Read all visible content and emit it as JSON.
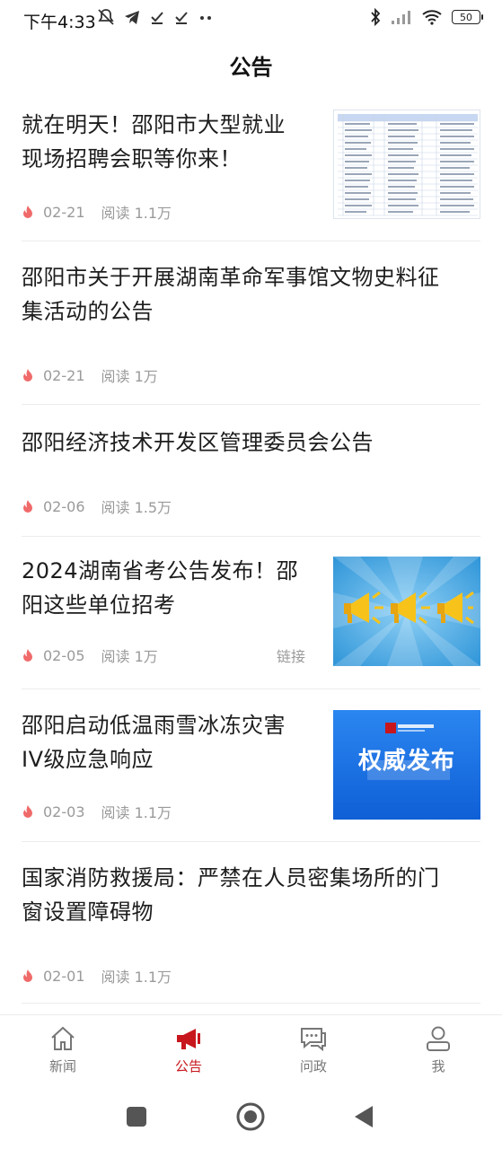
{
  "status_bar": {
    "time": "下午4:33",
    "battery": "50"
  },
  "page_title": "公告",
  "items": [
    {
      "title_line1": "就在明天！邵阳市大型就业",
      "title_line2": "现场招聘会职等你来！",
      "date": "02-21",
      "reads": "阅读 1.1万",
      "thumb": "table-image"
    },
    {
      "title_line1": "邵阳市关于开展湖南革命军事馆文物史料征",
      "title_line2": "集活动的公告",
      "date": "02-21",
      "reads": "阅读 1万"
    },
    {
      "title_line1": "邵阳经济技术开发区管理委员会公告",
      "date": "02-06",
      "reads": "阅读 1.5万"
    },
    {
      "title_line1": "2024湖南省考公告发布！邵",
      "title_line2": "阳这些单位招考",
      "date": "02-05",
      "reads": "阅读 1万",
      "tag": "链接",
      "thumb": "megaphones-image"
    },
    {
      "title_line1": "邵阳启动低温雨雪冰冻灾害",
      "title_line2": "IV级应急响应",
      "date": "02-03",
      "reads": "阅读 1.1万",
      "thumb": "authority-release-image",
      "thumb_text": "权威发布"
    },
    {
      "title_line1": "国家消防救援局：严禁在人员密集场所的门",
      "title_line2": "窗设置障碍物",
      "date": "02-01",
      "reads": "阅读 1.1万"
    }
  ],
  "bottom_nav": [
    {
      "label": "新闻",
      "icon": "home-icon"
    },
    {
      "label": "公告",
      "icon": "megaphone-icon",
      "active": true
    },
    {
      "label": "问政",
      "icon": "chat-icon"
    },
    {
      "label": "我",
      "icon": "user-icon"
    }
  ],
  "colors": {
    "accent": "#c8161d",
    "flame": "#f06a6a",
    "thumb_blue": "#1a6fe0"
  }
}
